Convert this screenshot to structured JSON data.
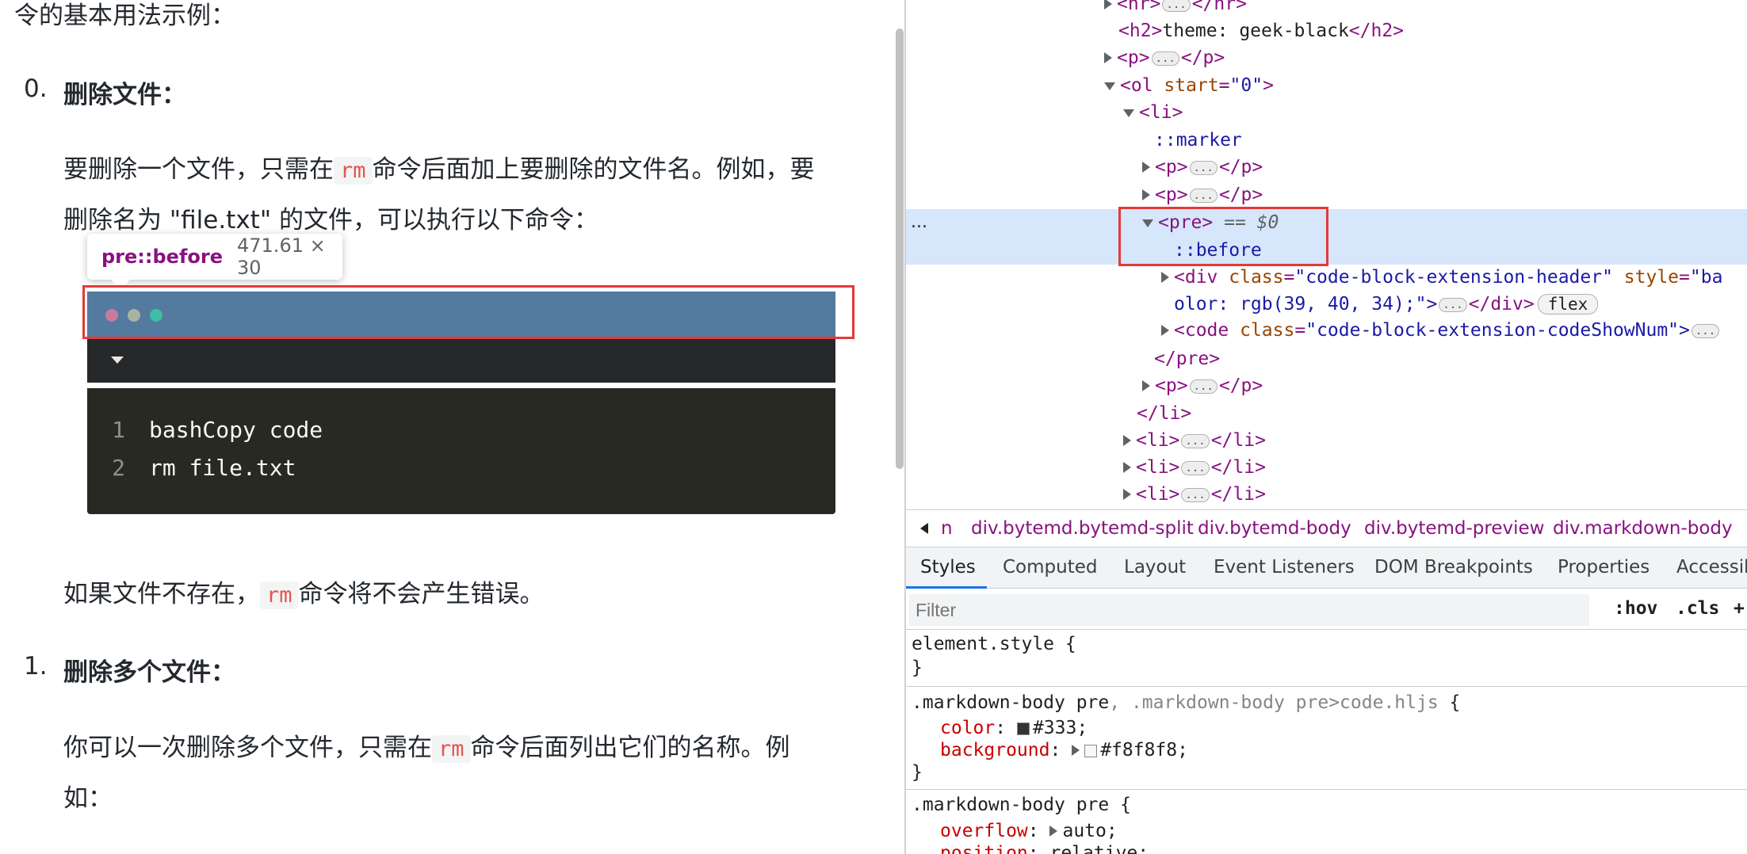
{
  "preview": {
    "intro": "令的基本用法示例：",
    "items": [
      {
        "number": "0.",
        "title": "删除文件：",
        "para1_a": "要删除一个文件，只需在",
        "code1": "rm",
        "para1_b": "命令后面加上要删除的文件名。例如，要",
        "para1_c": "删除名为 \"file.txt\" 的文件，可以执行以下命令：",
        "para2_a": "如果文件不存在，",
        "code2": "rm",
        "para2_b": "命令将不会产生错误。"
      },
      {
        "number": "1.",
        "title": "删除多个文件：",
        "para1_a": "你可以一次删除多个文件，只需在",
        "code1": "rm",
        "para1_b": "命令后面列出它们的名称。例",
        "para1_c": "如："
      }
    ],
    "tooltip": {
      "selector": "pre::before",
      "size": "471.61 × 30"
    },
    "code_block": {
      "dot_colors": [
        "#c77a9b",
        "#a6b3a0",
        "#3dbfa3"
      ],
      "lines": [
        {
          "num": "1",
          "text": "bashCopy code"
        },
        {
          "num": "2",
          "text": "rm file.txt"
        }
      ]
    },
    "highlight_color": "#e53935"
  },
  "devtools": {
    "dom": {
      "l0_tag_open": "<hr>",
      "l0_tag_close": "</hr>",
      "l1_open": "<h2>",
      "l1_text": "theme: geek-black",
      "l1_close": "</h2>",
      "l2_open": "<p>",
      "l2_close": "</p>",
      "l3_open": "<ol",
      "l3_attr": "start",
      "l3_val": "\"0\"",
      "l3_end": ">",
      "l4": "<li>",
      "l5": "::marker",
      "l6_open": "<p>",
      "l6_close": "</p>",
      "l7_open": "<p>",
      "l7_close": "</p>",
      "l8_tag": "<pre>",
      "l8_ref": "== $0",
      "l8_dots": "...",
      "l9": "::before",
      "l10_open": "<div",
      "l10_attr1": "class",
      "l10_val1": "\"code-block-extension-header\"",
      "l10_attr2": "style",
      "l10_val2": "\"ba",
      "l11_text": "olor: rgb(39, 40, 34);\">",
      "l11_close": "</div>",
      "l11_badge": "flex",
      "l12_open": "<code",
      "l12_attr": "class",
      "l12_val": "\"code-block-extension-codeShowNum\">",
      "l13": "</pre>",
      "l14_open": "<p>",
      "l14_close": "</p>",
      "l15": "</li>",
      "l16_open": "<li>",
      "l16_close": "</li>",
      "l17_open": "<li>",
      "l17_close": "</li>",
      "l18_open": "<li>",
      "l18_close": "</li>",
      "ellipsis": "..."
    },
    "breadcrumb": [
      "n",
      "div.bytemd.bytemd-split",
      "div.bytemd-body",
      "div.bytemd-preview",
      "div.markdown-body"
    ],
    "tabs": [
      "Styles",
      "Computed",
      "Layout",
      "Event Listeners",
      "DOM Breakpoints",
      "Properties",
      "Accessib"
    ],
    "active_tab": "Styles",
    "filter": {
      "placeholder": "Filter",
      "hov": ":hov",
      "cls": ".cls",
      "plus": "+"
    },
    "css": {
      "r1_selector": "element.style {",
      "r1_close": "}",
      "r2_selector": ".markdown-body pre",
      "r2_selector_dim": ", .markdown-body pre>code.hljs",
      "r2_open": " {",
      "r2_p1": "color",
      "r2_v1": "#333;",
      "r2_p2": "background",
      "r2_v2": "#f8f8f8;",
      "r2_close": "}",
      "r3_selector": ".markdown-body pre {",
      "r3_p1": "overflow",
      "r3_v1": "auto;",
      "r3_p2": "position",
      "r3_v2": "relative;",
      "swatch1": "#333333",
      "swatch2": "#f8f8f8"
    }
  }
}
